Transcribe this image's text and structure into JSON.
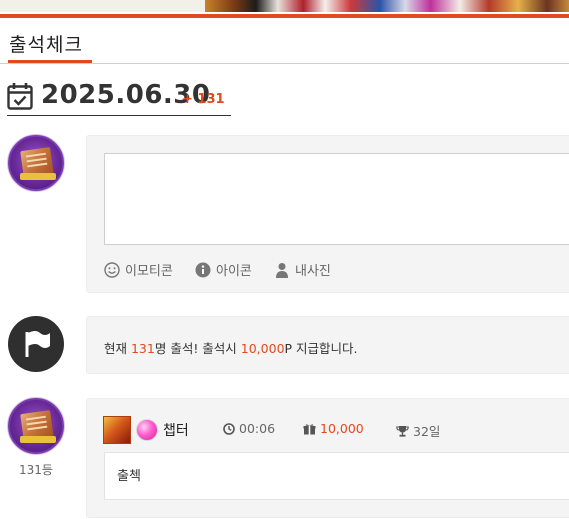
{
  "tab": {
    "label": "출석체크"
  },
  "date": {
    "value": "2025.06.30",
    "plus": "+ 131"
  },
  "editor": {
    "tools": [
      {
        "label": "이모티콘",
        "icon": "smile-icon"
      },
      {
        "label": "아이콘",
        "icon": "info-icon"
      },
      {
        "label": "내사진",
        "icon": "person-icon"
      }
    ]
  },
  "notice": {
    "prefix": "현재 ",
    "count": "131",
    "middle": "명 출석! 출석시 ",
    "reward": "10,000",
    "suffix": "P 지급합니다."
  },
  "post": {
    "nickname": "챕터",
    "time": "00:06",
    "points": "10,000",
    "days": "32일",
    "rank": "131등",
    "content": "출첵"
  },
  "colors": {
    "accent": "#e14a1e",
    "text": "#333333",
    "box": "#f4f4f4"
  }
}
